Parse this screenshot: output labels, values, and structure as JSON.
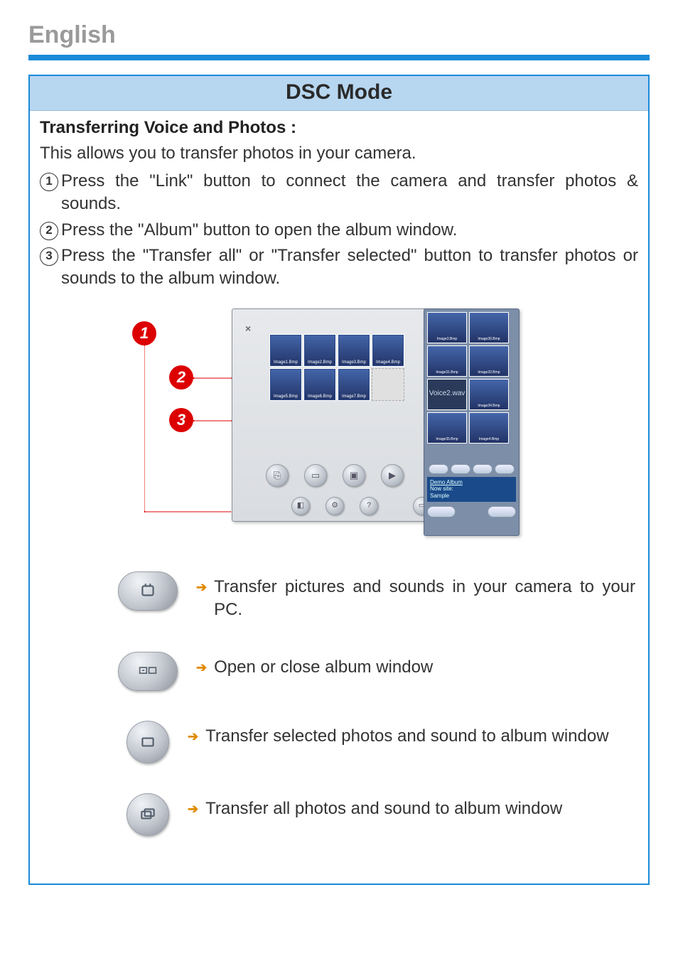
{
  "header": {
    "language": "English"
  },
  "panel": {
    "title": "DSC Mode",
    "subheading": "Transferring Voice and Photos :",
    "intro": "This allows you to transfer photos in your  camera.",
    "steps": [
      {
        "num": "1",
        "text": "Press the \"Link\" button to connect the camera and transfer photos & sounds."
      },
      {
        "num": "2",
        "text": "Press the \"Album\" button to open the album window."
      },
      {
        "num": "3",
        "text": "Press the \"Transfer all\" or \"Transfer selected\" button to transfer photos or sounds to the album window."
      }
    ]
  },
  "figure": {
    "callouts": [
      "1",
      "2",
      "3"
    ],
    "main_thumbs": [
      "Image1.Bmp",
      "Image2.Bmp",
      "Image3.Bmp",
      "Image4.Bmp",
      "Image5.Bmp",
      "Image6.Bmp",
      "Image7.Bmp"
    ],
    "album_thumbs": [
      "Image3.Bmp",
      "Image30.Bmp",
      "Image31.Bmp",
      "Image32.Bmp",
      "Voice2.wav",
      "Image34.Bmp",
      "Image35.Bmp",
      "Image4.Bmp"
    ],
    "album_label_title": "Demo Album",
    "album_label_lines": "Now site:\nSample"
  },
  "legend": [
    {
      "icon": "link-icon",
      "text": "Transfer pictures and sounds in your camera to your PC."
    },
    {
      "icon": "album-icon",
      "text": "Open or close album  window"
    },
    {
      "icon": "transfer-selected-icon",
      "text": "Transfer selected photos and sound to album window"
    },
    {
      "icon": "transfer-all-icon",
      "text": "Transfer all photos and sound to album window"
    }
  ]
}
